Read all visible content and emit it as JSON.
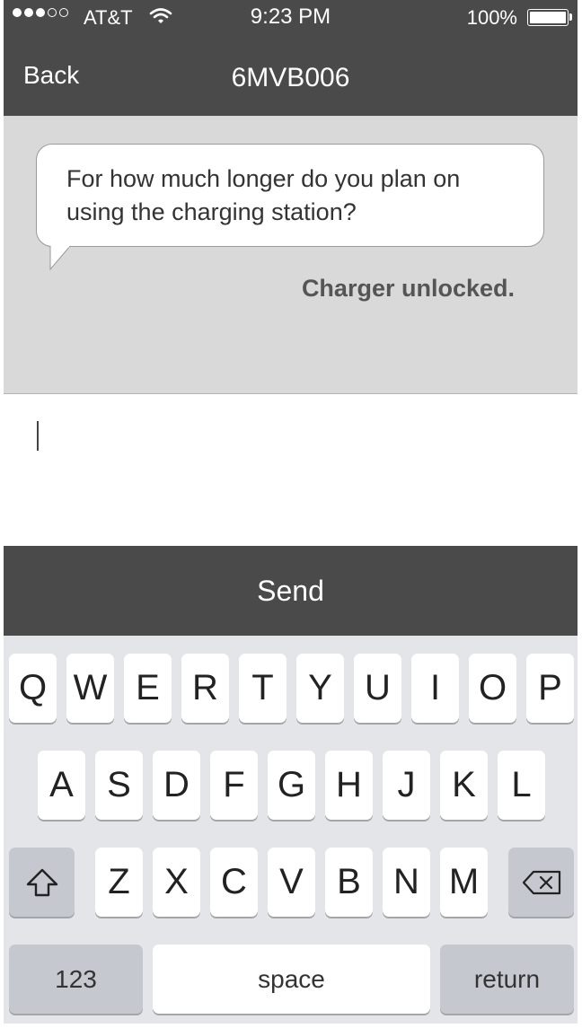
{
  "status_bar": {
    "carrier": "AT&T",
    "time": "9:23 PM",
    "battery_percent": "100%",
    "signal_bars_filled": 3,
    "signal_bars_total": 5
  },
  "nav": {
    "back_label": "Back",
    "title": "6MVB006"
  },
  "chat": {
    "message_line1": "For how much longer do you plan on",
    "message_line2": "using the charging station?",
    "status": "Charger unlocked."
  },
  "input": {
    "value": ""
  },
  "send_label": "Send",
  "keyboard": {
    "row1": [
      "Q",
      "W",
      "E",
      "R",
      "T",
      "Y",
      "U",
      "I",
      "O",
      "P"
    ],
    "row2": [
      "A",
      "S",
      "D",
      "F",
      "G",
      "H",
      "J",
      "K",
      "L"
    ],
    "row3": [
      "Z",
      "X",
      "C",
      "V",
      "B",
      "N",
      "M"
    ],
    "numbers_label": "123",
    "space_label": "space",
    "return_label": "return",
    "shift_icon": "shift-arrow-icon",
    "delete_icon": "backspace-icon"
  },
  "colors": {
    "bar_dark": "#4a4a4a",
    "chat_bg": "#d9d9d9",
    "keyboard_bg": "#e4e5e8"
  }
}
